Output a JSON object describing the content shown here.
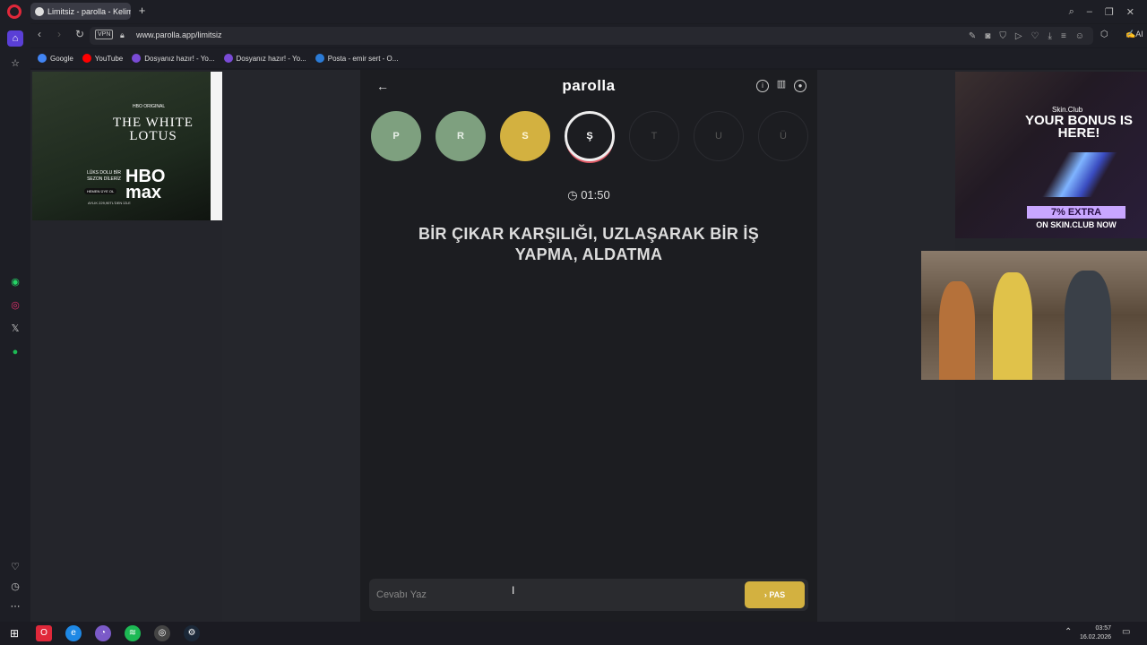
{
  "browser": {
    "tab_title": "Limitsiz - parolla - Kelime",
    "url": "www.parolla.app/limitsiz",
    "vpn_label": "VPN",
    "ai_label": "AI"
  },
  "bookmarks": [
    {
      "label": "Google",
      "color": "#4285f4"
    },
    {
      "label": "YouTube",
      "color": "#ff0000"
    },
    {
      "label": "Dosyanız hazır! - Yo...",
      "color": "#7a4bd6"
    },
    {
      "label": "Dosyanız hazır! - Yo...",
      "color": "#7a4bd6"
    },
    {
      "label": "Posta - emir sert - O...",
      "color": "#2b7bd6"
    }
  ],
  "ads": {
    "left": {
      "hbo_original": "HBO ORIGINAL",
      "title": "THE WHITE LOTUS",
      "tagline": "LÜKS DOLU BİR SEZON DİLERİZ",
      "cta": "HEMEN ÜYE OL",
      "brand": "HBO max",
      "price": "AYLIK 229,90TL'DEN İZLE"
    },
    "right": {
      "logo": "Skin.Club",
      "headline": "YOUR BONUS IS HERE!",
      "extra": "7% EXTRA",
      "site": "ON SKIN.CLUB NOW"
    }
  },
  "app": {
    "logo": "parolla",
    "letters": [
      {
        "letter": "P",
        "state": "done"
      },
      {
        "letter": "R",
        "state": "done"
      },
      {
        "letter": "S",
        "state": "pass"
      },
      {
        "letter": "Ş",
        "state": "active"
      },
      {
        "letter": "T",
        "state": "future"
      },
      {
        "letter": "U",
        "state": "future"
      },
      {
        "letter": "Ü",
        "state": "future"
      }
    ],
    "timer": "01:50",
    "question": "BİR ÇIKAR KARŞILIĞI, UZLAŞARAK BİR İŞ YAPMA, ALDATMA",
    "answer_placeholder": "Cevabı Yaz",
    "pass_label": "PAS"
  },
  "colors": {
    "correct": "#7ea07f",
    "pass": "#d3b140",
    "active_ring": "#e05a66"
  },
  "taskbar": {
    "time": "03:57",
    "date": "16.02.2026"
  }
}
